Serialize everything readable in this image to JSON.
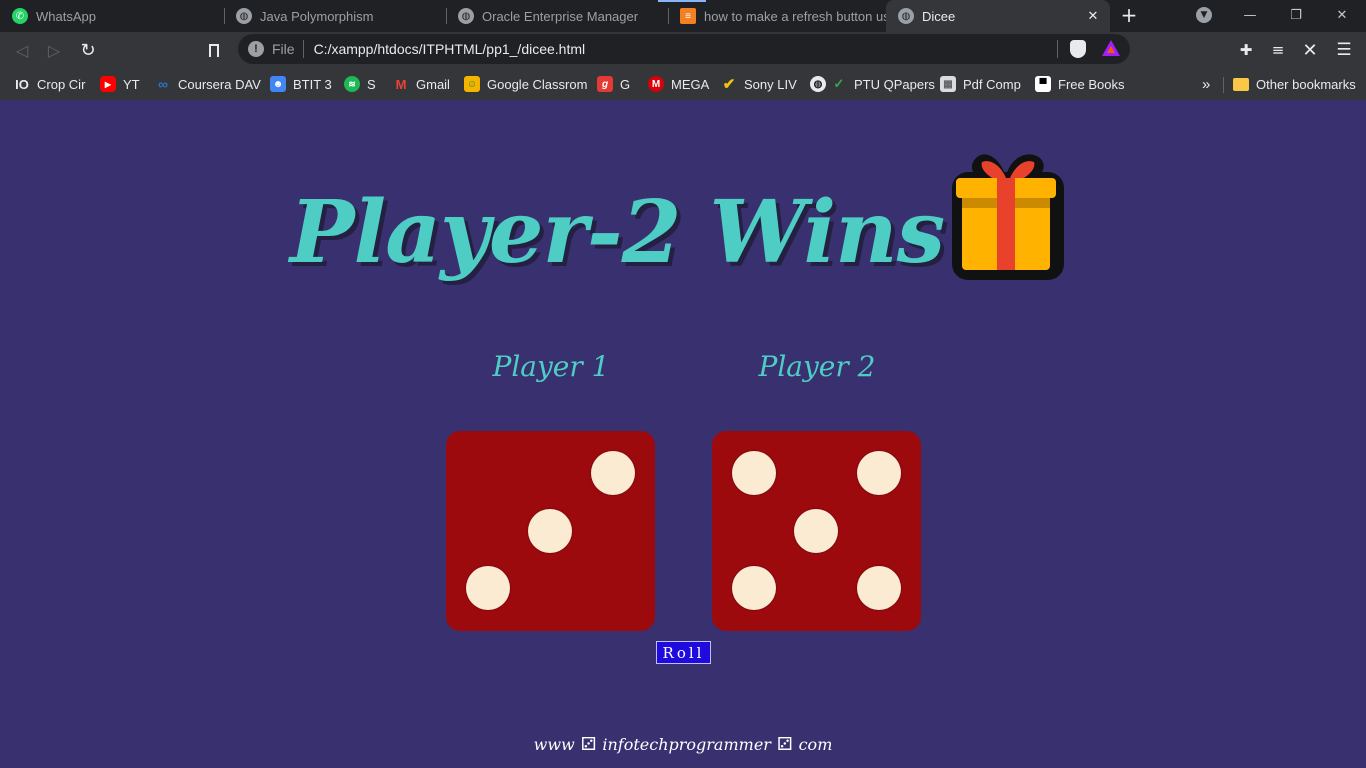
{
  "browser": {
    "tabs": [
      {
        "label": "WhatsApp",
        "icon": "whatsapp-icon"
      },
      {
        "label": "Java Polymorphism",
        "icon": "globe-icon"
      },
      {
        "label": "Oracle Enterprise Manager",
        "icon": "globe-icon"
      },
      {
        "label": "how to make a refresh button usi",
        "icon": "stackoverflow-icon"
      },
      {
        "label": "Dicee",
        "icon": "globe-icon",
        "active": true
      }
    ],
    "address": {
      "scheme_label": "File",
      "url": "C:/xampp/htdocs/ITPHTML/pp1_/dicee.html"
    },
    "bookmarks": [
      {
        "label": "Crop Cir",
        "icon": "io-icon"
      },
      {
        "label": "YT",
        "icon": "youtube-icon"
      },
      {
        "label": "Coursera DAV",
        "icon": "coursera-icon"
      },
      {
        "label": "BTIT 3",
        "icon": "contacts-icon"
      },
      {
        "label": "S",
        "icon": "spotify-icon"
      },
      {
        "label": "Gmail",
        "icon": "gmail-icon"
      },
      {
        "label": "Google Classrom",
        "icon": "classroom-icon"
      },
      {
        "label": "G",
        "icon": "g-icon"
      },
      {
        "label": "MEGA",
        "icon": "mega-icon"
      },
      {
        "label": "Sony LIV",
        "icon": "checkmark-icon"
      },
      {
        "label": "PTU QPapers",
        "icon": "globe-check-icon"
      },
      {
        "label": "Pdf Comp",
        "icon": "pdf-icon"
      },
      {
        "label": "Free Books",
        "icon": "books-icon"
      }
    ],
    "overflow_label": "»",
    "other_bookmarks": "Other bookmarks"
  },
  "page": {
    "heading": "Player-2 Wins",
    "players": [
      {
        "label": "Player 1",
        "die_value": 3
      },
      {
        "label": "Player 2",
        "die_value": 5
      }
    ],
    "roll_button": "Roll",
    "footer": {
      "part1": "www",
      "part2": "infotechprogrammer",
      "part3": "com",
      "separator_icon": "die-icon"
    }
  },
  "colors": {
    "page_background": "#393070",
    "heading": "#4ecdc4",
    "die": "#9c0a0e",
    "pip": "#faebd2",
    "roll_button": "#1f0bde"
  }
}
